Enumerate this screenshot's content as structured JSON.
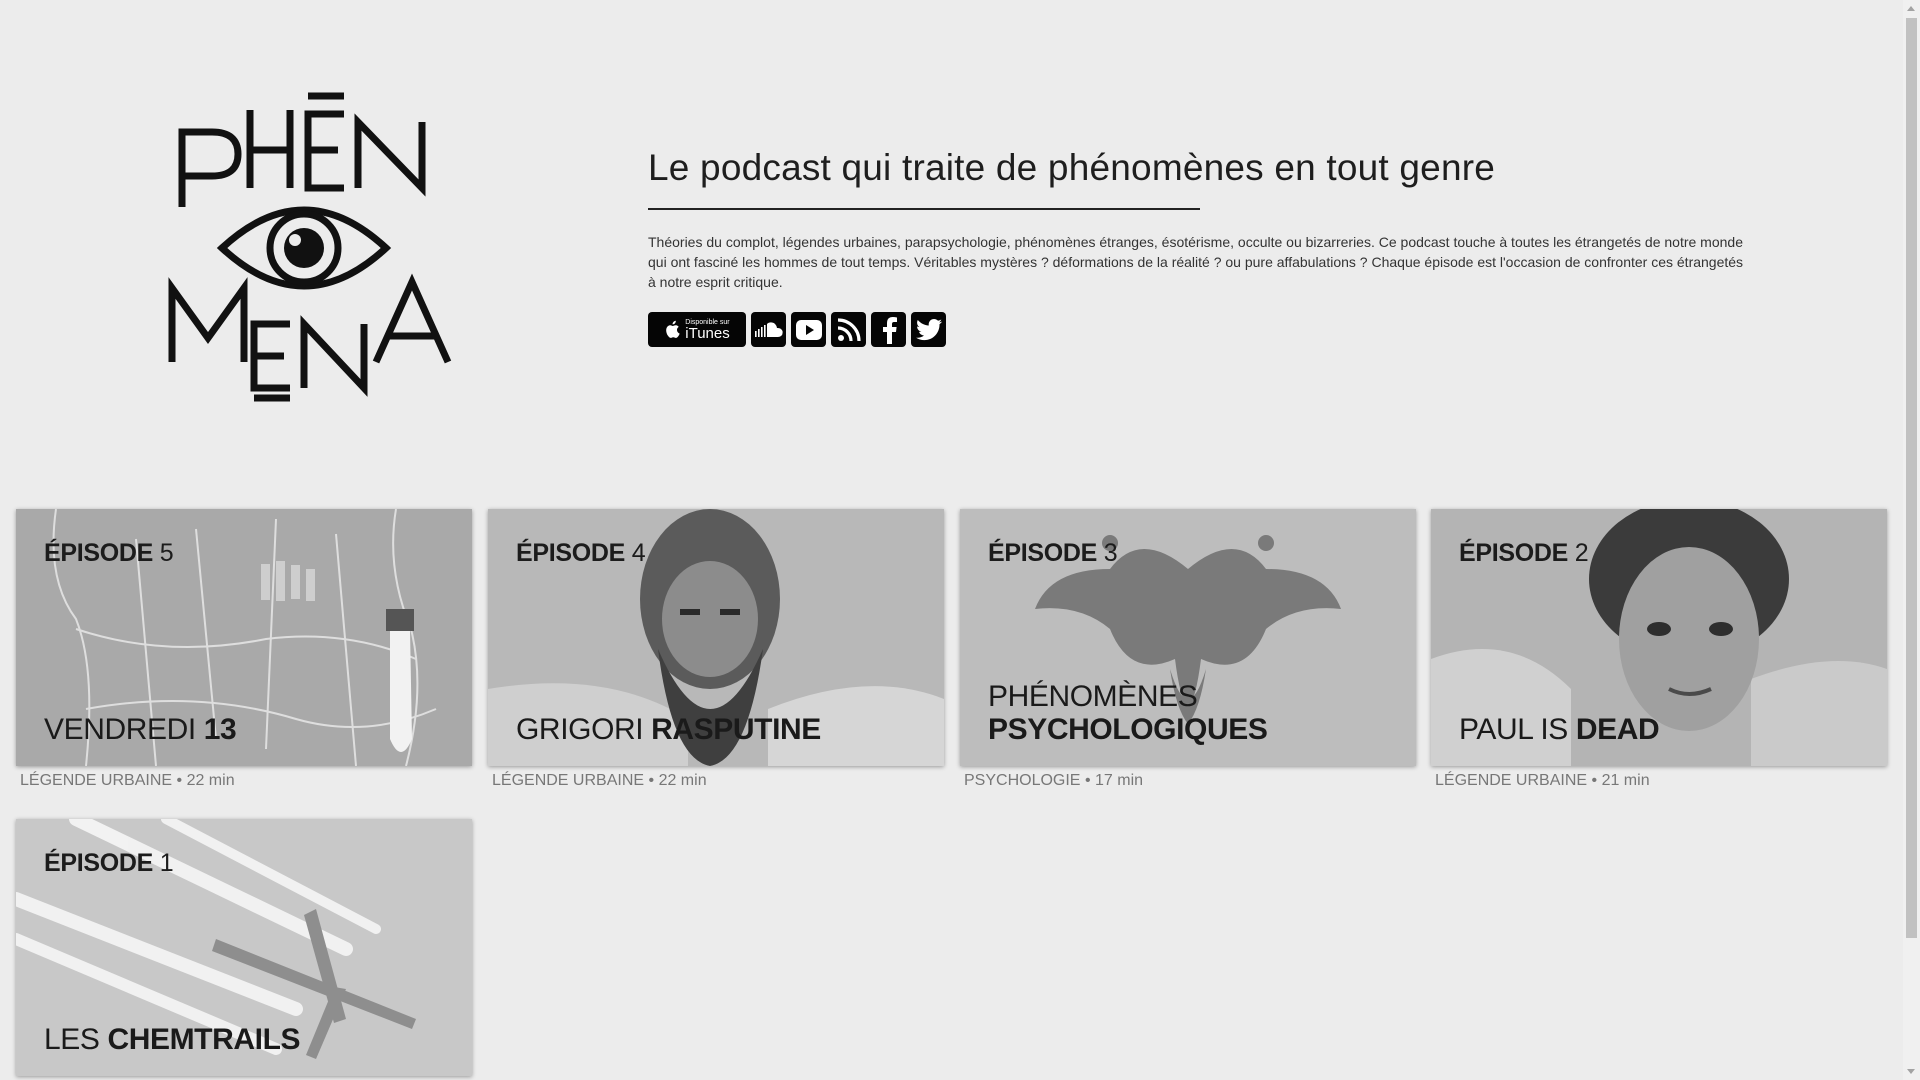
{
  "logo": {
    "line1": "PHĒN",
    "line2": "MENA"
  },
  "intro": {
    "heading": "Le podcast qui traite de phénomènes en tout genre",
    "description": "Théories du complot, légendes urbaines, parapsychologie, phénomènes étranges, ésotérisme, occulte ou bizarreries. Ce podcast touche à toutes les étrangetés de notre monde qui ont fasciné les hommes de tout temps. Véritables mystères ? déformations de la réalité ? ou pure affabulations ? Chaque épisode est l'occasion de confronter ces étrangetés à notre esprit critique."
  },
  "socials": {
    "itunes_small": "Disponible sur",
    "itunes_big": "iTunes",
    "icons": [
      "apple-icon",
      "soundcloud-icon",
      "youtube-icon",
      "rss-icon",
      "facebook-icon",
      "twitter-icon"
    ]
  },
  "episodes": [
    {
      "ep_label": "ÉPISODE",
      "ep_num": "5",
      "title_light": "VENDREDI",
      "title_bold": "13",
      "category": "LÉGENDE URBAINE",
      "duration": "22 min"
    },
    {
      "ep_label": "ÉPISODE",
      "ep_num": "4",
      "title_light": "GRIGORI",
      "title_bold": "RASPUTINE",
      "category": "LÉGENDE URBAINE",
      "duration": "22 min"
    },
    {
      "ep_label": "ÉPISODE",
      "ep_num": "3",
      "title_light": "PHÉNOMÈNES",
      "title_bold": "PSYCHOLOGIQUES",
      "category": "PSYCHOLOGIE",
      "duration": "17 min"
    },
    {
      "ep_label": "ÉPISODE",
      "ep_num": "2",
      "title_light": "PAUL IS",
      "title_bold": "DEAD",
      "category": "LÉGENDE URBAINE",
      "duration": "21 min"
    },
    {
      "ep_label": "ÉPISODE",
      "ep_num": "1",
      "title_light": "LES",
      "title_bold": "CHEMTRAILS",
      "category": "",
      "duration": ""
    }
  ],
  "meta_separator": "•",
  "colors": {
    "background": "#ececec",
    "card_tint": "#bdbdbd",
    "button_black": "#050505",
    "meta_gray": "#777777"
  }
}
